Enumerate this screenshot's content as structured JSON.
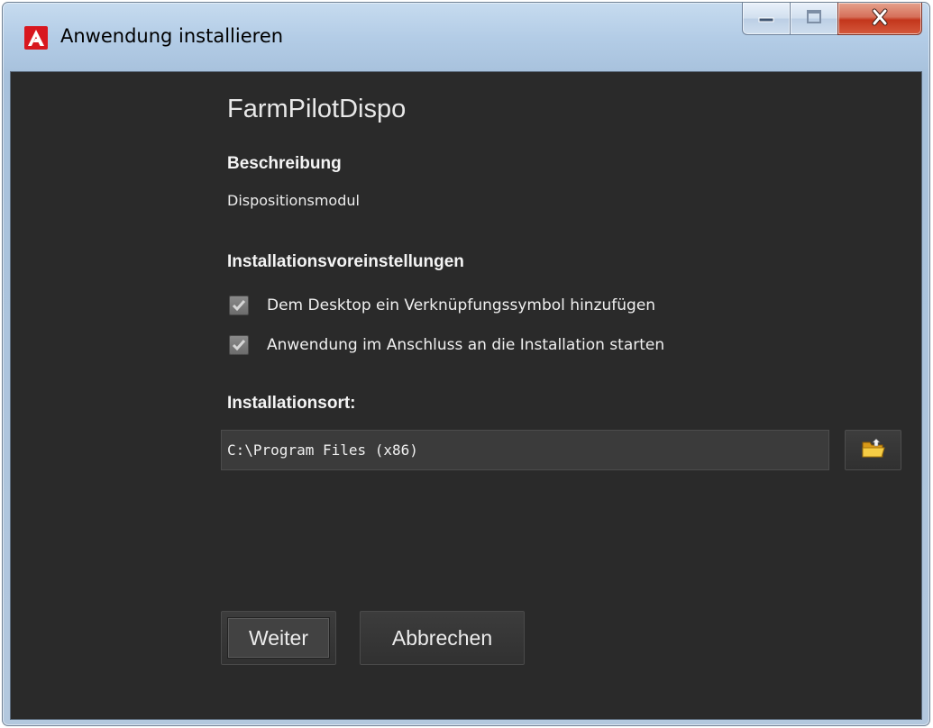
{
  "window": {
    "title": "Anwendung installieren",
    "icon": "adobe-air-icon",
    "controls": [
      "minimize-icon",
      "maximize-icon",
      "close-icon"
    ]
  },
  "app": {
    "name": "FarmPilotDispo"
  },
  "description": {
    "heading": "Beschreibung",
    "text": "Dispositionsmodul"
  },
  "preferences": {
    "heading": "Installationsvoreinstellungen",
    "options": [
      {
        "label": "Dem Desktop ein Verknüpfungssymbol hinzufügen",
        "checked": true
      },
      {
        "label": "Anwendung im Anschluss an die Installation starten",
        "checked": true
      }
    ]
  },
  "location": {
    "heading": "Installationsort:",
    "path": "C:\\Program Files (x86)",
    "browse_icon": "folder-icon"
  },
  "buttons": {
    "next": "Weiter",
    "cancel": "Abbrechen"
  }
}
